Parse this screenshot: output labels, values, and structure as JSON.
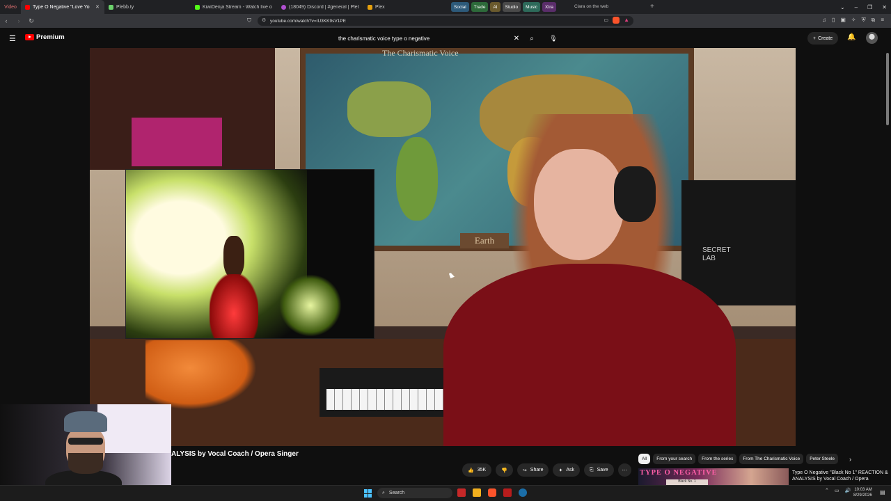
{
  "browser": {
    "video_tab_label": "Video",
    "tabs": [
      {
        "label": "Type O Negative \"Love You to Death\"...",
        "favicon_color": "#ff0000",
        "active": true
      },
      {
        "label": "Plebb.ty",
        "favicon_color": "#6bd16b",
        "active": false
      },
      {
        "label": "KiwiDenja Stream - Watch live on Ki...",
        "favicon_color": "#53fc18",
        "active": false
      },
      {
        "label": "(18049) Discord | #general | Plebb...",
        "favicon_color": "#b04fd0",
        "active": false
      },
      {
        "label": "Plex",
        "favicon_color": "#e5a00d",
        "active": false
      }
    ],
    "bookmark_groups": [
      {
        "label": "Social",
        "color": "#2d5a7a"
      },
      {
        "label": "Trade",
        "color": "#2d6a3a"
      },
      {
        "label": "AI",
        "color": "#6a5a2d"
      },
      {
        "label": "Studio",
        "color": "#4a4a4a"
      },
      {
        "label": "Music",
        "color": "#2d6a5a"
      },
      {
        "label": "Xtra",
        "color": "#5a2d6a"
      }
    ],
    "extra_tab": "Clara on the web",
    "url": "youtube.com/watch?v=IU3KK9sV1PE"
  },
  "youtube": {
    "logo_label": "Premium",
    "search_query": "the charismatic voice type o negative",
    "create_label": "Create",
    "video_title": "ALYSIS by Vocal Coach / Opera Singer",
    "actions": {
      "like_count": "35K",
      "share_label": "Share",
      "ask_label": "Ask",
      "save_label": "Save"
    },
    "chips": [
      "All",
      "From your search",
      "From the series",
      "From The Charismatic Voice",
      "Peter Steele"
    ],
    "recommended": {
      "thumb_title": "TYPE O NEGATIVE",
      "thumb_subtitle": "Black No. 1",
      "title": "Type O Negative \"Black No 1\" REACTION & ANALYSIS by Vocal Coach / Opera"
    }
  },
  "video_scene": {
    "map_title": "The Charismatic Voice",
    "map_plate": "Earth",
    "pillow_text": "SECRET LAB"
  },
  "taskbar": {
    "search_label": "Search",
    "time": "10:03 AM",
    "date": "8/29/2026"
  }
}
